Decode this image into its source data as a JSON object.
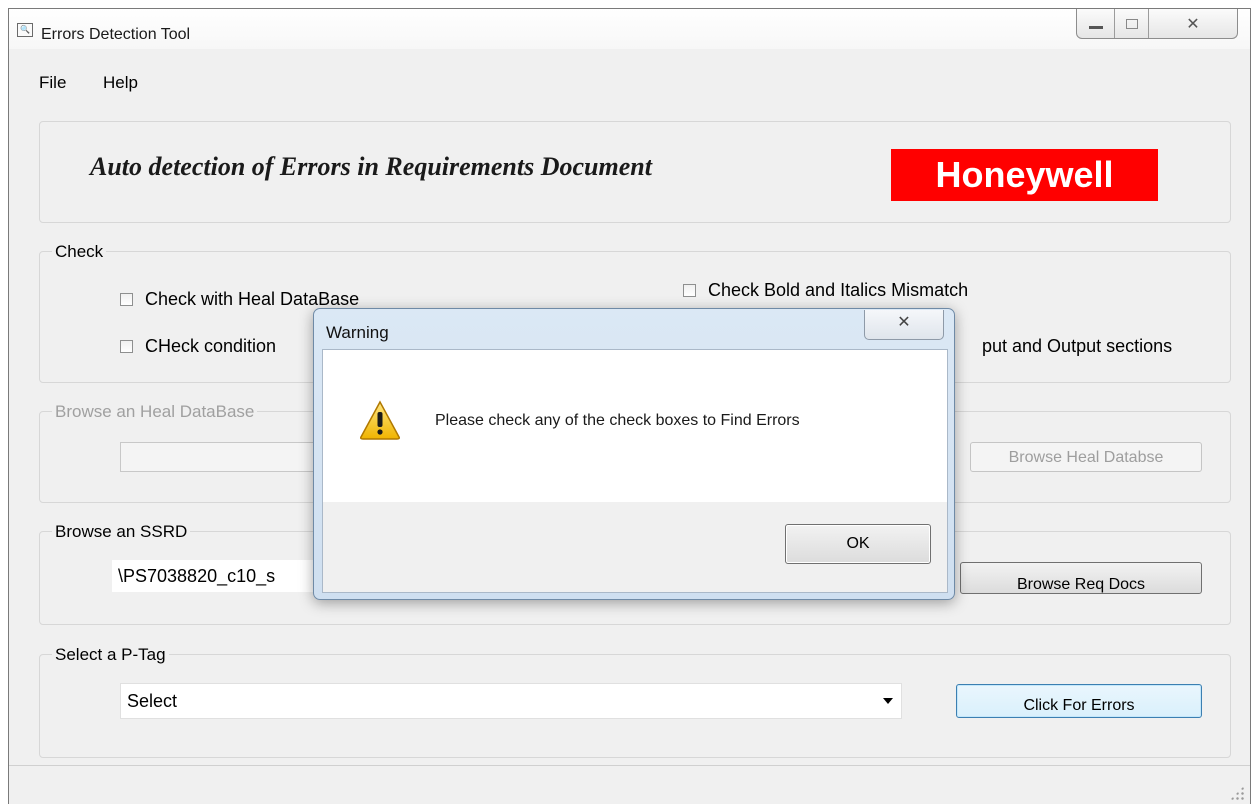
{
  "window": {
    "title": "Errors Detection Tool",
    "app_icon": "magnifier-icon",
    "controls": {
      "minimize": "minimize-icon",
      "maximize": "maximize-icon",
      "close": "✕"
    }
  },
  "menu": [
    "File",
    "Help"
  ],
  "banner": {
    "title": "Auto detection of Errors in Requirements Document",
    "logo": "Honeywell",
    "logo_color": "#ff0000"
  },
  "check": {
    "legend": "Check",
    "options": {
      "heal_db": {
        "label": "Check with Heal DataBase",
        "checked": false
      },
      "bold_italics": {
        "label": "Check Bold and Italics Mismatch",
        "checked": false
      },
      "conditions": {
        "label": "CHeck condition",
        "checked": false
      },
      "io_sections": {
        "label": "put and Output sections",
        "checked": false
      }
    }
  },
  "browse_heal": {
    "legend": "Browse an Heal DataBase",
    "path": "",
    "button": "Browse Heal Databse",
    "enabled": false
  },
  "browse_ssrd": {
    "legend": "Browse an SSRD",
    "path": "\\PS7038820_c10_s",
    "button": "Browse Req Docs"
  },
  "ptag": {
    "legend": "Select a P-Tag",
    "selected": "Select",
    "button": "Click For Errors"
  },
  "dialog": {
    "title": "Warning",
    "close": "✕",
    "icon": "warning-icon",
    "message": "Please check any of the check boxes to Find Errors",
    "ok": "OK"
  }
}
